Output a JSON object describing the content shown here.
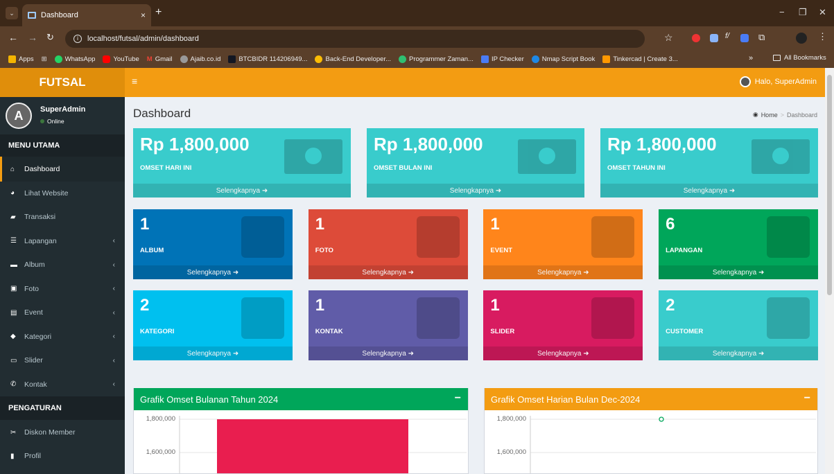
{
  "browser": {
    "tab_title": "Dashboard",
    "url": "localhost/futsal/admin/dashboard",
    "bookmarks": [
      "Apps",
      "WhatsApp",
      "YouTube",
      "Gmail",
      "Ajaib.co.id",
      "BTCBIDR 114206949...",
      "Back-End Developer...",
      "Programmer Zaman...",
      "IP Checker",
      "Nmap Script Book",
      "Tinkercad | Create 3..."
    ],
    "all_bookmarks": "All Bookmarks",
    "more": "»"
  },
  "app": {
    "logo": "FUTSAL",
    "greeting": "Halo, SuperAdmin",
    "menu_toggle": "≡"
  },
  "user": {
    "name": "SuperAdmin",
    "status": "Online"
  },
  "sidebar": {
    "section_main": "MENU UTAMA",
    "items": [
      {
        "label": "Dashboard",
        "icon": "home-icon"
      },
      {
        "label": "Lihat Website",
        "icon": "globe-icon"
      },
      {
        "label": "Transaksi",
        "icon": "credit-card-icon"
      },
      {
        "label": "Lapangan",
        "icon": "list-icon"
      },
      {
        "label": "Album",
        "icon": "folder-icon"
      },
      {
        "label": "Foto",
        "icon": "image-icon"
      },
      {
        "label": "Event",
        "icon": "newspaper-icon"
      },
      {
        "label": "Kategori",
        "icon": "tag-icon"
      },
      {
        "label": "Slider",
        "icon": "slider-icon"
      },
      {
        "label": "Kontak",
        "icon": "phone-icon"
      }
    ],
    "section_settings": "PENGATURAN",
    "settings_items": [
      {
        "label": "Diskon Member",
        "icon": "scissors-icon"
      },
      {
        "label": "Profil",
        "icon": "file-icon"
      }
    ]
  },
  "page": {
    "title": "Dashboard",
    "breadcrumb_home": "Home",
    "breadcrumb_sep": ">",
    "breadcrumb_current": "Dashboard"
  },
  "more_label": "Selengkapnya",
  "omset": [
    {
      "value": "Rp 1,800,000",
      "label": "OMSET HARI INI"
    },
    {
      "value": "Rp 1,800,000",
      "label": "OMSET BULAN INI"
    },
    {
      "value": "Rp 1,800,000",
      "label": "OMSET TAHUN INI"
    }
  ],
  "stats": [
    {
      "value": "1",
      "label": "ALBUM",
      "color": "#0073b7"
    },
    {
      "value": "1",
      "label": "FOTO",
      "color": "#dd4b39"
    },
    {
      "value": "1",
      "label": "EVENT",
      "color": "#ff851b"
    },
    {
      "value": "6",
      "label": "LAPANGAN",
      "color": "#00a65a"
    },
    {
      "value": "2",
      "label": "KATEGORI",
      "color": "#00c0ef"
    },
    {
      "value": "1",
      "label": "KONTAK",
      "color": "#605ca8"
    },
    {
      "value": "1",
      "label": "SLIDER",
      "color": "#d81b60"
    },
    {
      "value": "2",
      "label": "CUSTOMER",
      "color": "#39cccc"
    }
  ],
  "panels": {
    "monthly": {
      "title": "Grafik Omset Bulanan Tahun 2024",
      "color": "#00a65a",
      "minimize": "−"
    },
    "daily": {
      "title": "Grafik Omset Harian Bulan Dec-2024",
      "color": "#f39c12",
      "minimize": "−"
    }
  },
  "chart_data": [
    {
      "type": "bar",
      "title": "Grafik Omset Bulanan Tahun 2024",
      "y_ticks": [
        "1,800,000",
        "1,600,000"
      ],
      "values": [
        1800000
      ],
      "color": "#e91e4f"
    },
    {
      "type": "line",
      "title": "Grafik Omset Harian Bulan Dec-2024",
      "y_ticks": [
        "1,800,000",
        "1,600,000"
      ],
      "values": [
        1800000
      ],
      "color": "#00a65a"
    }
  ]
}
